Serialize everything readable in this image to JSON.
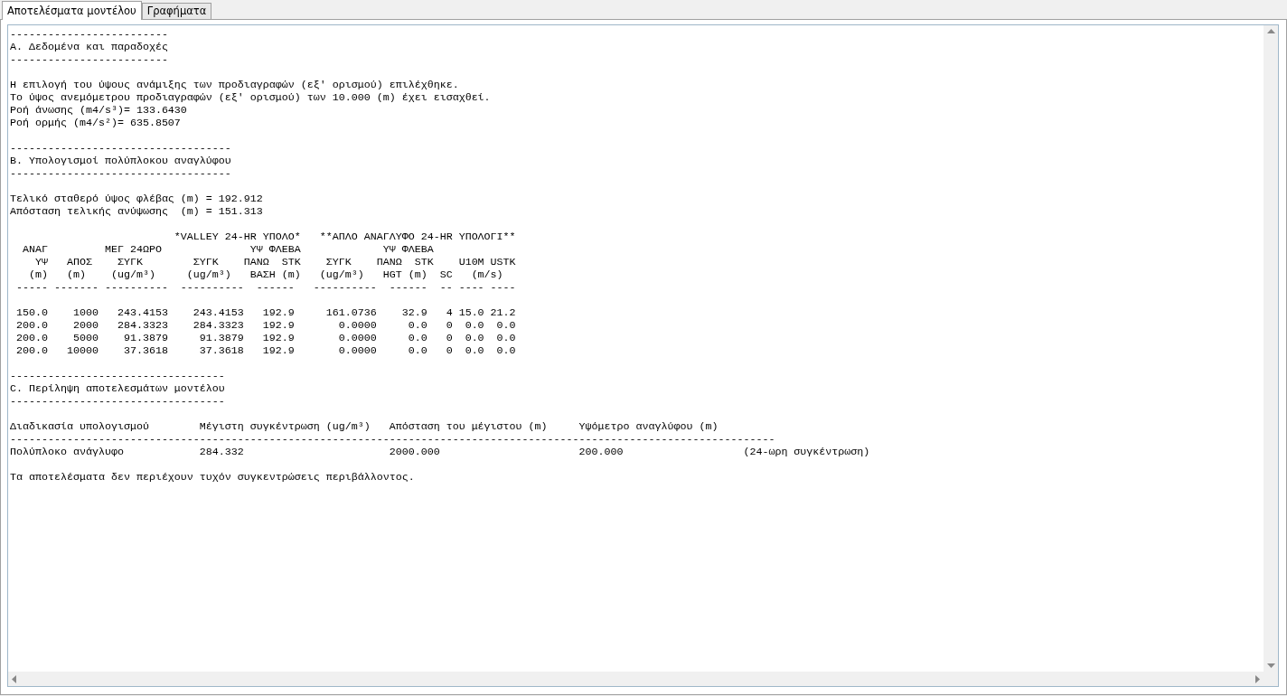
{
  "tabs": [
    {
      "label": "Αποτελέσματα μοντέλου",
      "selected": true
    },
    {
      "label": "Γραφήματα",
      "selected": false
    }
  ],
  "output_blocks": [
    [
      "-------------------------",
      "Α. Δεδομένα και παραδοχές",
      "-------------------------"
    ],
    [
      "Η επιλογή του ύψους ανάμιξης των προδιαγραφών (εξ' ορισμού) επιλέχθηκε.",
      "Το ύψος ανεμόμετρου προδιαγραφών (εξ' ορισμού) των 10.000 (m) έχει εισαχθεί.",
      "Ροή άνωσης (m4/s³)= 133.6430",
      "Ροή ορμής (m4/s²)= 635.8507"
    ],
    [
      "-----------------------------------",
      "Β. Υπολογισμοί πολύπλοκου αναγλύφου",
      "-----------------------------------"
    ],
    [
      "Τελικό σταθερό ύψος φλέβας (m) = 192.912",
      "Απόσταση τελικής ανύψωσης  (m) = 151.313"
    ],
    [
      "                          *VALLEY 24-HR ΥΠΟΛΟ*   **ΑΠΛΟ ΑΝΑΓΛΥΦΟ 24-HR ΥΠΟΛΟΓΙ**",
      "  ΑΝΑΓ         ΜΕΓ 24ΩΡΟ              ΥΨ ΦΛΕΒΑ             ΥΨ ΦΛΕΒΑ",
      "    ΥΨ   ΑΠΟΣ    ΣΥΓΚ        ΣΥΓΚ    ΠΑΝΩ  STK    ΣΥΓΚ    ΠΑΝΩ  STK    U10M USTK",
      "   (m)   (m)    (ug/m³)     (ug/m³)   ΒΑΣΗ (m)   (ug/m³)   HGT (m)  SC   (m/s)",
      " ----- ------- ----------  ----------  ------   ----------  ------  -- ---- ----"
    ],
    [
      " 150.0    1000   243.4153    243.4153   192.9     161.0736    32.9   4 15.0 21.2",
      " 200.0    2000   284.3323    284.3323   192.9       0.0000     0.0   0  0.0  0.0",
      " 200.0    5000    91.3879     91.3879   192.9       0.0000     0.0   0  0.0  0.0",
      " 200.0   10000    37.3618     37.3618   192.9       0.0000     0.0   0  0.0  0.0"
    ],
    [
      "----------------------------------",
      "C. Περίληψη αποτελεσμάτων μοντέλου",
      "----------------------------------"
    ],
    [
      "Διαδικασία υπολογισμού        Μέγιστη συγκέντρωση (ug/m³)   Απόσταση του μέγιστου (m)     Υψόμετρο αναγλύφου (m)",
      "-------------------------------------------------------------------------------------------------------------------------",
      "Πολύπλοκο ανάγλυφο            284.332                       2000.000                      200.000                   (24-ωρη συγκέντρωση)"
    ],
    [
      "Τα αποτελέσματα δεν περιέχουν τυχόν συγκεντρώσεις περιβάλλοντος."
    ]
  ]
}
